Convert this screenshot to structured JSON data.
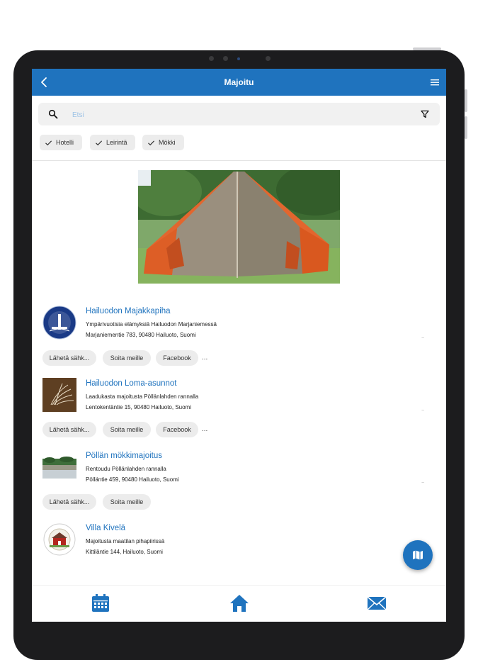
{
  "colors": {
    "primary": "#1f73be",
    "chip_bg": "#ececec"
  },
  "appbar": {
    "title": "Majoitu",
    "back_icon": "chevron-left-icon",
    "menu_icon": "hamburger-menu-icon"
  },
  "search": {
    "placeholder": "Etsi",
    "value": ""
  },
  "filters": [
    {
      "label": "Hotelli",
      "checked": true
    },
    {
      "label": "Leirintä",
      "checked": true
    },
    {
      "label": "Mökki",
      "checked": true
    }
  ],
  "listings": [
    {
      "title": "Hailuodon Majakkapiha",
      "description": "Ympärivuotisia elämyksiä Hailuodon Marjaniemessä",
      "address": "Marjaniementie 783, 90480 Hailuoto, Suomi",
      "more": "..",
      "actions": [
        "Lähetä sähk...",
        "Soita meille",
        "Facebook"
      ],
      "overflow": "..."
    },
    {
      "title": "Hailuodon Loma-asunnot",
      "description": "Laadukasta majoitusta Pöllänlahden rannalla",
      "address": "Lentokentäntie 15, 90480 Hailuoto, Suomi",
      "more": "..",
      "actions": [
        "Lähetä sähk...",
        "Soita meille",
        "Facebook"
      ],
      "overflow": "..."
    },
    {
      "title": "Pöllän mökkimajoitus",
      "description": "Rentoudu Pöllänlahden rannalla",
      "address": "Pölläntie 459, 90480 Hailuoto, Suomi",
      "more": "..",
      "actions": [
        "Lähetä sähk...",
        "Soita meille"
      ]
    },
    {
      "title": "Villa Kivelä",
      "description": "Majoitusta maatilan pihapiirissä",
      "address": "Kittiläntie 144, Hailuoto, Suomi"
    }
  ],
  "fab": {
    "icon": "map-icon"
  },
  "bottom_nav": [
    {
      "icon": "calendar-icon"
    },
    {
      "icon": "home-icon"
    },
    {
      "icon": "mail-icon"
    }
  ]
}
